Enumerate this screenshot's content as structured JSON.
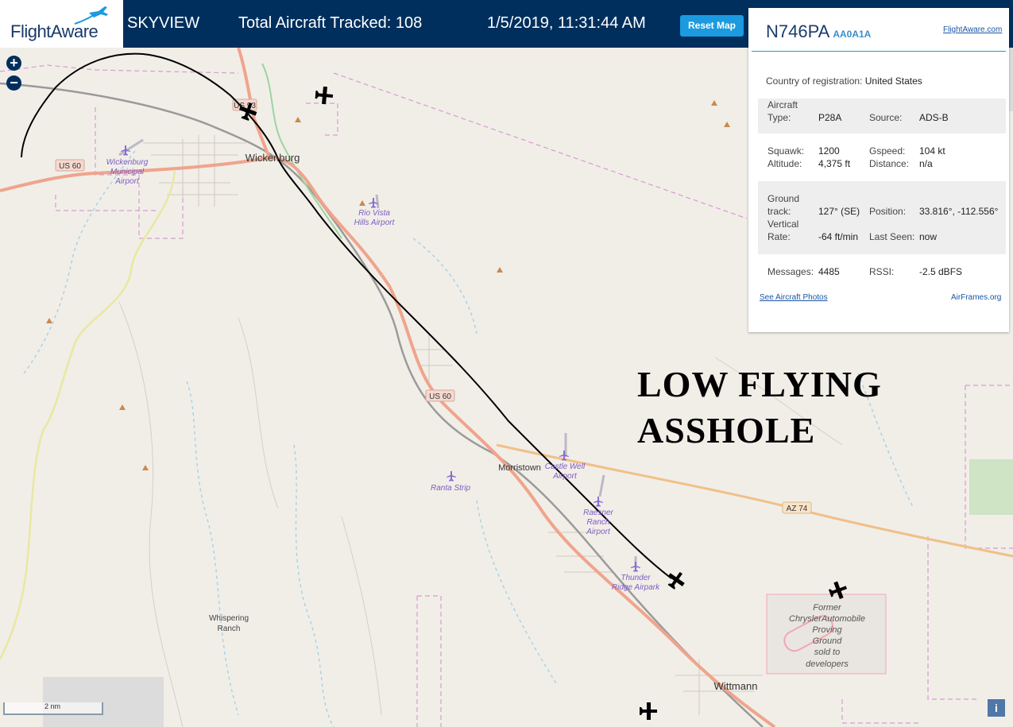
{
  "header": {
    "logo_text": "FlightAware",
    "app_name": "SKYVIEW",
    "tracked": "Total Aircraft Tracked: 108",
    "datetime": "1/5/2019, 11:31:44 AM",
    "reset_label": "Reset Map"
  },
  "zoom": {
    "in": "+",
    "out": "−"
  },
  "map": {
    "labels": {
      "wickenburg": "Wickenburg",
      "airport_1": "Wickenburg",
      "airport_2": "Municipal",
      "airport_3": "Airport",
      "rio_1": "Rio Vista",
      "rio_2": "Hills Airport",
      "morristown": "Morristown",
      "castle_1": "Castle Well",
      "castle_2": "Airport",
      "ranta": "Ranta Strip",
      "raesner_1": "Raesner",
      "raesner_2": "Ranch",
      "raesner_3": "Airport",
      "thunder_1": "Thunder",
      "thunder_2": "Ridge Airpark",
      "whisper_1": "Whispering",
      "whisper_2": "Ranch",
      "chrysler_1": "Former",
      "chrysler_2": "ChryslerAutomobile",
      "chrysler_3": "Proving",
      "chrysler_4": "Ground",
      "chrysler_5": "sold to",
      "chrysler_6": "developers",
      "wittmann": "Wittmann",
      "us60_a": "US 60",
      "us60_b": "US 60",
      "us93": "US 93",
      "az74": "AZ 74"
    },
    "scale": "2 nm",
    "info": "i"
  },
  "annotation": {
    "line1": "LOW FLYING",
    "line2": "ASSHOLE"
  },
  "panel": {
    "registration": "N746PA",
    "hex": "AA0A1A",
    "fa_link": "FlightAware.com",
    "country_label": "Country of registration:",
    "country_value": "United States",
    "aircraft_type_label_1": "Aircraft",
    "aircraft_type_label_2": "Type:",
    "aircraft_type": "P28A",
    "source_label": "Source:",
    "source": "ADS-B",
    "squawk_label": "Squawk:",
    "squawk": "1200",
    "gspeed_label": "Gspeed:",
    "gspeed": "104 kt",
    "altitude_label": "Altitude:",
    "altitude": "4,375 ft",
    "distance_label": "Distance:",
    "distance": "n/a",
    "track_label_1": "Ground",
    "track_label_2": "track:",
    "track": "127° (SE)",
    "position_label": "Position:",
    "position": "33.816°, -112.556°",
    "vrate_label_1": "Vertical",
    "vrate_label_2": "Rate:",
    "vrate": "-64 ft/min",
    "last_seen_label": "Last Seen:",
    "last_seen": "now",
    "messages_label": "Messages:",
    "messages": "4485",
    "rssi_label": "RSSI:",
    "rssi": "-2.5 dBFS",
    "photos_link": "See Aircraft Photos",
    "airframes_link": "AirFrames.org"
  },
  "colors": {
    "header_bg": "#002f5d",
    "accent": "#1b9ae0",
    "highway": "#f0a48c",
    "track_line": "#000000"
  }
}
